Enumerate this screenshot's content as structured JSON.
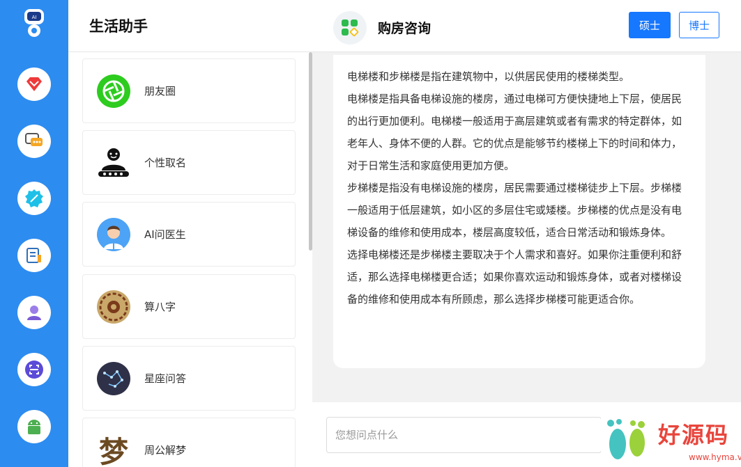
{
  "rail": {
    "items": [
      {
        "icon": "ruby-icon",
        "color": "#ee3a3a"
      },
      {
        "icon": "chat-bubbles-icon",
        "color": "#f5a623"
      },
      {
        "icon": "feather-badge-icon",
        "color": "#1ec0e8"
      },
      {
        "icon": "notes-icon",
        "color": "#2f6fb8"
      },
      {
        "icon": "user-icon",
        "color": "#7b5cd6"
      },
      {
        "icon": "scan-icon",
        "color": "#5b4bd8"
      },
      {
        "icon": "android-icon",
        "color": "#4caf50"
      }
    ]
  },
  "list_panel": {
    "title": "生活助手",
    "items": [
      {
        "label": "朋友圈",
        "icon": "camera-aperture-icon"
      },
      {
        "label": "个性取名",
        "icon": "naming-person-icon"
      },
      {
        "label": "AI问医生",
        "icon": "doctor-avatar-icon"
      },
      {
        "label": "算八字",
        "icon": "bagua-icon"
      },
      {
        "label": "星座问答",
        "icon": "constellation-icon"
      },
      {
        "label": "周公解梦",
        "icon": "dream-char-icon",
        "glyph": "梦"
      }
    ]
  },
  "chat": {
    "title": "购房咨询",
    "buttons": {
      "master": "硕士",
      "doctor": "博士"
    },
    "message": [
      "电梯楼和步梯楼是指在建筑物中，以供居民使用的楼梯类型。",
      "电梯楼是指具备电梯设施的楼房，通过电梯可方便快捷地上下层，使居民的出行更加便利。电梯楼一般适用于高层建筑或者有需求的特定群体，如老年人、身体不便的人群。它的优点是能够节约楼梯上下的时间和体力，对于日常生活和家庭使用更加方便。",
      "步梯楼是指没有电梯设施的楼房，居民需要通过楼梯徒步上下层。步梯楼一般适用于低层建筑，如小区的多层住宅或矮楼。步梯楼的优点是没有电梯设备的维修和使用成本，楼层高度较低，适合日常活动和锻炼身体。",
      "选择电梯楼还是步梯楼主要取决于个人需求和喜好。如果你注重便利和舒适，那么选择电梯楼更合适；如果你喜欢运动和锻炼身体，或者对楼梯设备的维修和使用成本有所顾虑，那么选择步梯楼可能更适合你。"
    ],
    "input_placeholder": "您想问点什么"
  },
  "watermark": {
    "text": "好源码",
    "url": "www.hyma.vip"
  },
  "colors": {
    "accent": "#2d8cf0",
    "button": "#1677ff"
  }
}
